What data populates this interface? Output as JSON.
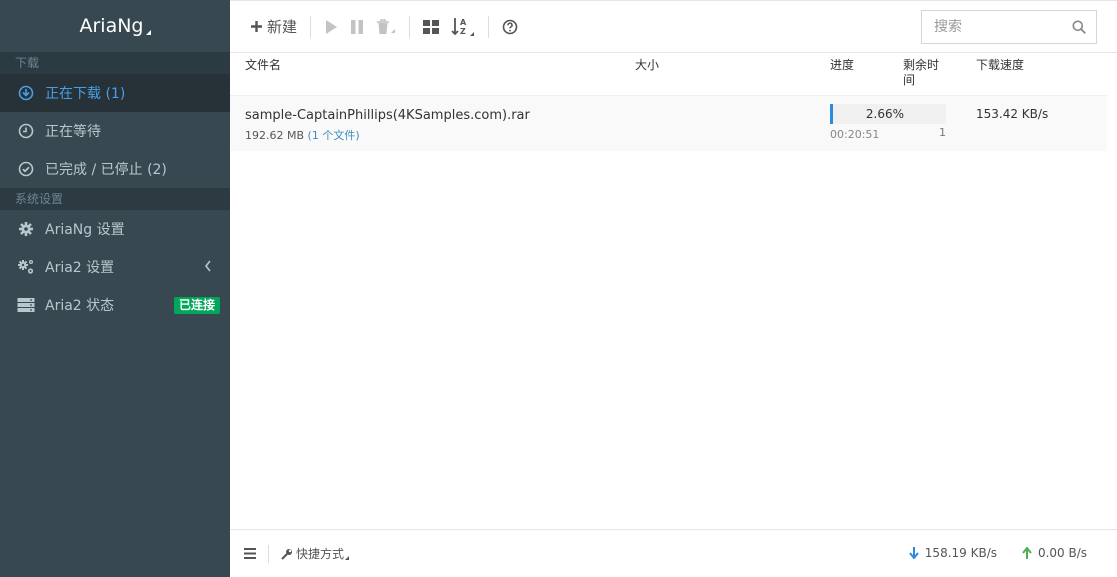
{
  "app": {
    "brand": "AriaNg"
  },
  "sidebar": {
    "download_header": "下载",
    "items": [
      {
        "label": "正在下载 (1)",
        "icon": "arrow-circle-down-icon",
        "active": true
      },
      {
        "label": "正在等待",
        "icon": "clock-icon"
      },
      {
        "label": "已完成 / 已停止 (2)",
        "icon": "check-circle-icon"
      }
    ],
    "settings_header": "系统设置",
    "settings": [
      {
        "label": "AriaNg 设置",
        "icon": "gear-icon"
      },
      {
        "label": "Aria2 设置",
        "icon": "gears-icon"
      },
      {
        "label": "Aria2 状态",
        "icon": "server-icon",
        "badge": "已连接"
      }
    ]
  },
  "toolbar": {
    "new_label": "新建",
    "search_placeholder": "搜索"
  },
  "table": {
    "headers": {
      "name": "文件名",
      "size": "大小",
      "progress": "进度",
      "remaining_line1": "剩余时",
      "remaining_line2": "间",
      "speed": "下载速度"
    },
    "rows": [
      {
        "name": "sample-CaptainPhillips(4KSamples.com).rar",
        "size": "192.62 MB",
        "files": "(1 个文件)",
        "progress_text": "2.66%",
        "progress": 0.0266,
        "remaining": "00:20:51",
        "connections": "1",
        "speed": "153.42 KB/s"
      }
    ]
  },
  "footer": {
    "shortcut_label": "快捷方式",
    "down_speed": "158.19 KB/s",
    "up_speed": "0.00 B/s"
  },
  "colors": {
    "sidebar_bg": "#374850",
    "active": "#4a9ee8",
    "badge": "#00a65a",
    "progress": "#2c8be0"
  }
}
